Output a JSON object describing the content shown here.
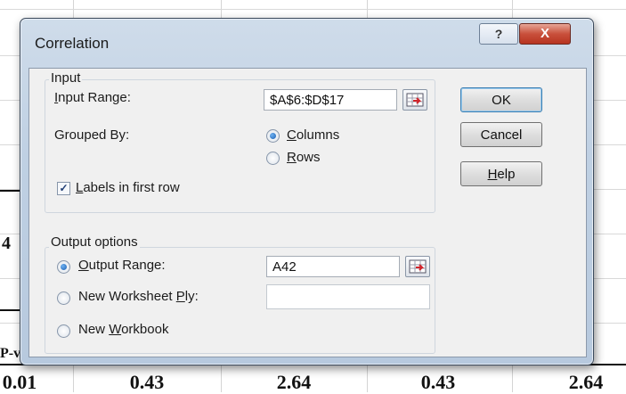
{
  "dialog": {
    "title": "Correlation",
    "title_help_label": "?",
    "title_close_label": "X"
  },
  "input_group": {
    "legend": "Input",
    "input_range_label": "Input Range:",
    "input_range_value": "$A$6:$D$17",
    "grouped_by_label": "Grouped By:",
    "columns_label": "Columns",
    "rows_label": "Rows",
    "columns_selected": true,
    "labels_in_first_row_label": "Labels in first row",
    "labels_in_first_row_checked": true
  },
  "output_group": {
    "legend": "Output options",
    "output_range_label": "Output Range:",
    "output_range_value": "A42",
    "new_worksheet_label": "New Worksheet Ply:",
    "new_worksheet_value": "",
    "new_workbook_label": "New Workbook",
    "selected": "output_range"
  },
  "buttons": {
    "ok": "OK",
    "cancel": "Cancel",
    "help": "Help"
  },
  "sheet": {
    "left_cell_4": "4",
    "left_cell_pv": "P-v",
    "bottom_row": [
      "0.01",
      "0.43",
      "2.64",
      "0.43",
      "2.64"
    ]
  }
}
